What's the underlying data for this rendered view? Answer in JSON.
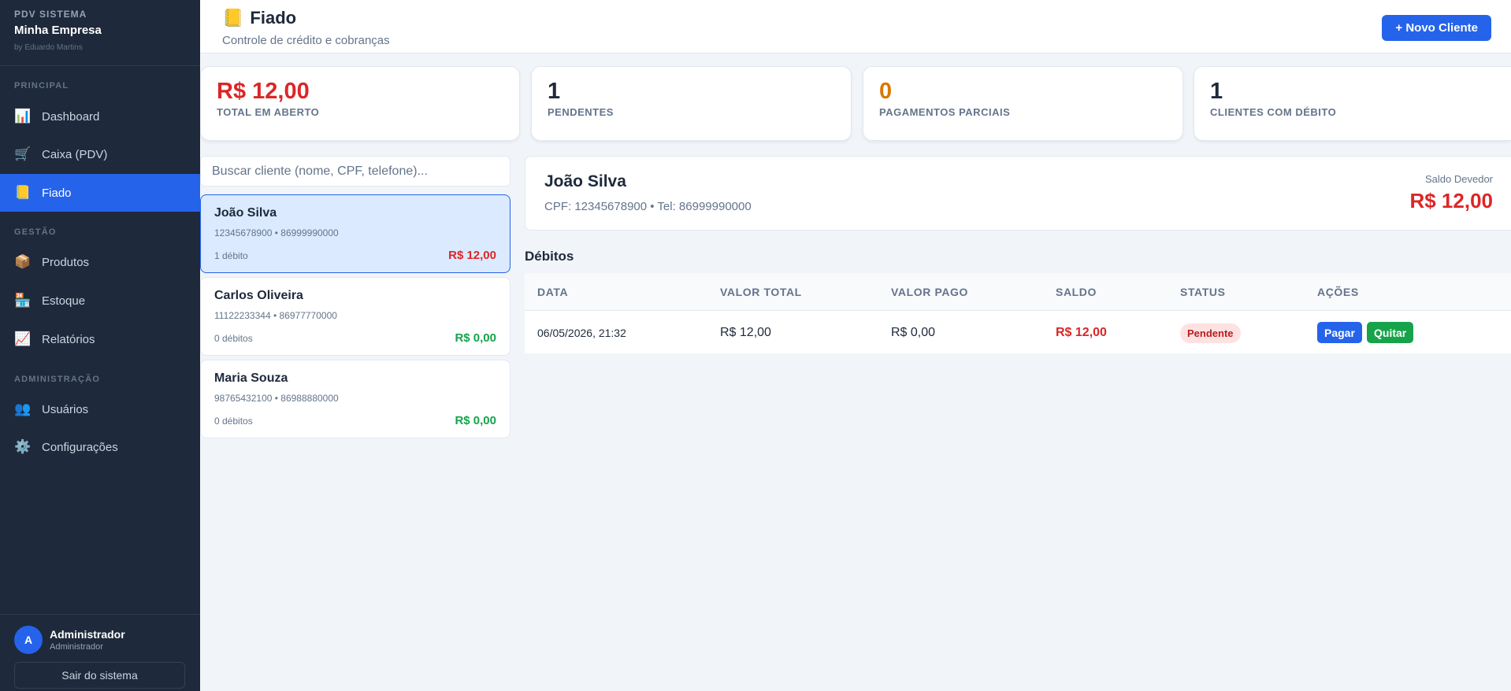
{
  "brand": {
    "system": "PDV SISTEMA",
    "company": "Minha Empresa",
    "by": "by Eduardo Martins"
  },
  "nav": {
    "sections": [
      "PRINCIPAL",
      "GESTÃO",
      "ADMINISTRAÇÃO"
    ],
    "items": [
      {
        "label": "Dashboard",
        "icon": "bar-chart-icon",
        "glyph": "📊"
      },
      {
        "label": "Caixa (PDV)",
        "icon": "shopping-cart-icon",
        "glyph": "🛒"
      },
      {
        "label": "Fiado",
        "icon": "ledger-icon",
        "glyph": "📒"
      },
      {
        "label": "Produtos",
        "icon": "package-icon",
        "glyph": "📦"
      },
      {
        "label": "Estoque",
        "icon": "store-icon",
        "glyph": "🏪"
      },
      {
        "label": "Relatórios",
        "icon": "trend-chart-icon",
        "glyph": "📈"
      },
      {
        "label": "Usuários",
        "icon": "users-icon",
        "glyph": "👥"
      },
      {
        "label": "Configurações",
        "icon": "gear-icon",
        "glyph": "⚙️"
      }
    ],
    "active": "Fiado"
  },
  "user": {
    "initial": "A",
    "name": "Administrador",
    "role": "Administrador",
    "logout_label": "Sair do sistema"
  },
  "header": {
    "title": "Fiado",
    "title_glyph": "📒",
    "subtitle": "Controle de crédito e cobranças",
    "new_client_label": "+ Novo Cliente"
  },
  "stats": [
    {
      "value": "R$ 12,00",
      "label": "TOTAL EM ABERTO",
      "color": "#dc2626"
    },
    {
      "value": "1",
      "label": "PENDENTES",
      "color": "#1e293b"
    },
    {
      "value": "0",
      "label": "PAGAMENTOS PARCIAIS",
      "color": "#d97706"
    },
    {
      "value": "1",
      "label": "CLIENTES COM DÉBITO",
      "color": "#1e293b"
    }
  ],
  "search": {
    "placeholder": "Buscar cliente (nome, CPF, telefone)...",
    "value": ""
  },
  "clients": [
    {
      "name": "João Silva",
      "meta": "12345678900 • 86999990000",
      "debits": "1 débito",
      "balance": "R$ 12,00",
      "balance_color": "#dc2626",
      "selected": true
    },
    {
      "name": "Carlos Oliveira",
      "meta": "11122233344 • 86977770000",
      "debits": "0 débitos",
      "balance": "R$ 0,00",
      "balance_color": "#16a34a",
      "selected": false
    },
    {
      "name": "Maria Souza",
      "meta": "98765432100 • 86988880000",
      "debits": "0 débitos",
      "balance": "R$ 0,00",
      "balance_color": "#16a34a",
      "selected": false
    }
  ],
  "detail": {
    "name": "João Silva",
    "meta": "CPF: 12345678900 • Tel: 86999990000",
    "balance_label": "Saldo Devedor",
    "balance_value": "R$ 12,00"
  },
  "debits": {
    "title": "Débitos",
    "columns": [
      "DATA",
      "VALOR TOTAL",
      "VALOR PAGO",
      "SALDO",
      "STATUS",
      "AÇÕES"
    ],
    "rows": [
      {
        "date": "06/05/2026, 21:32",
        "total": "R$ 12,00",
        "paid": "R$ 0,00",
        "balance": "R$ 12,00",
        "status": "Pendente",
        "pay_label": "Pagar",
        "settle_label": "Quitar"
      }
    ]
  },
  "colors": {
    "accent": "#2563eb",
    "danger": "#dc2626",
    "success": "#16a34a",
    "warning": "#d97706",
    "sidebar": "#1e293b"
  }
}
